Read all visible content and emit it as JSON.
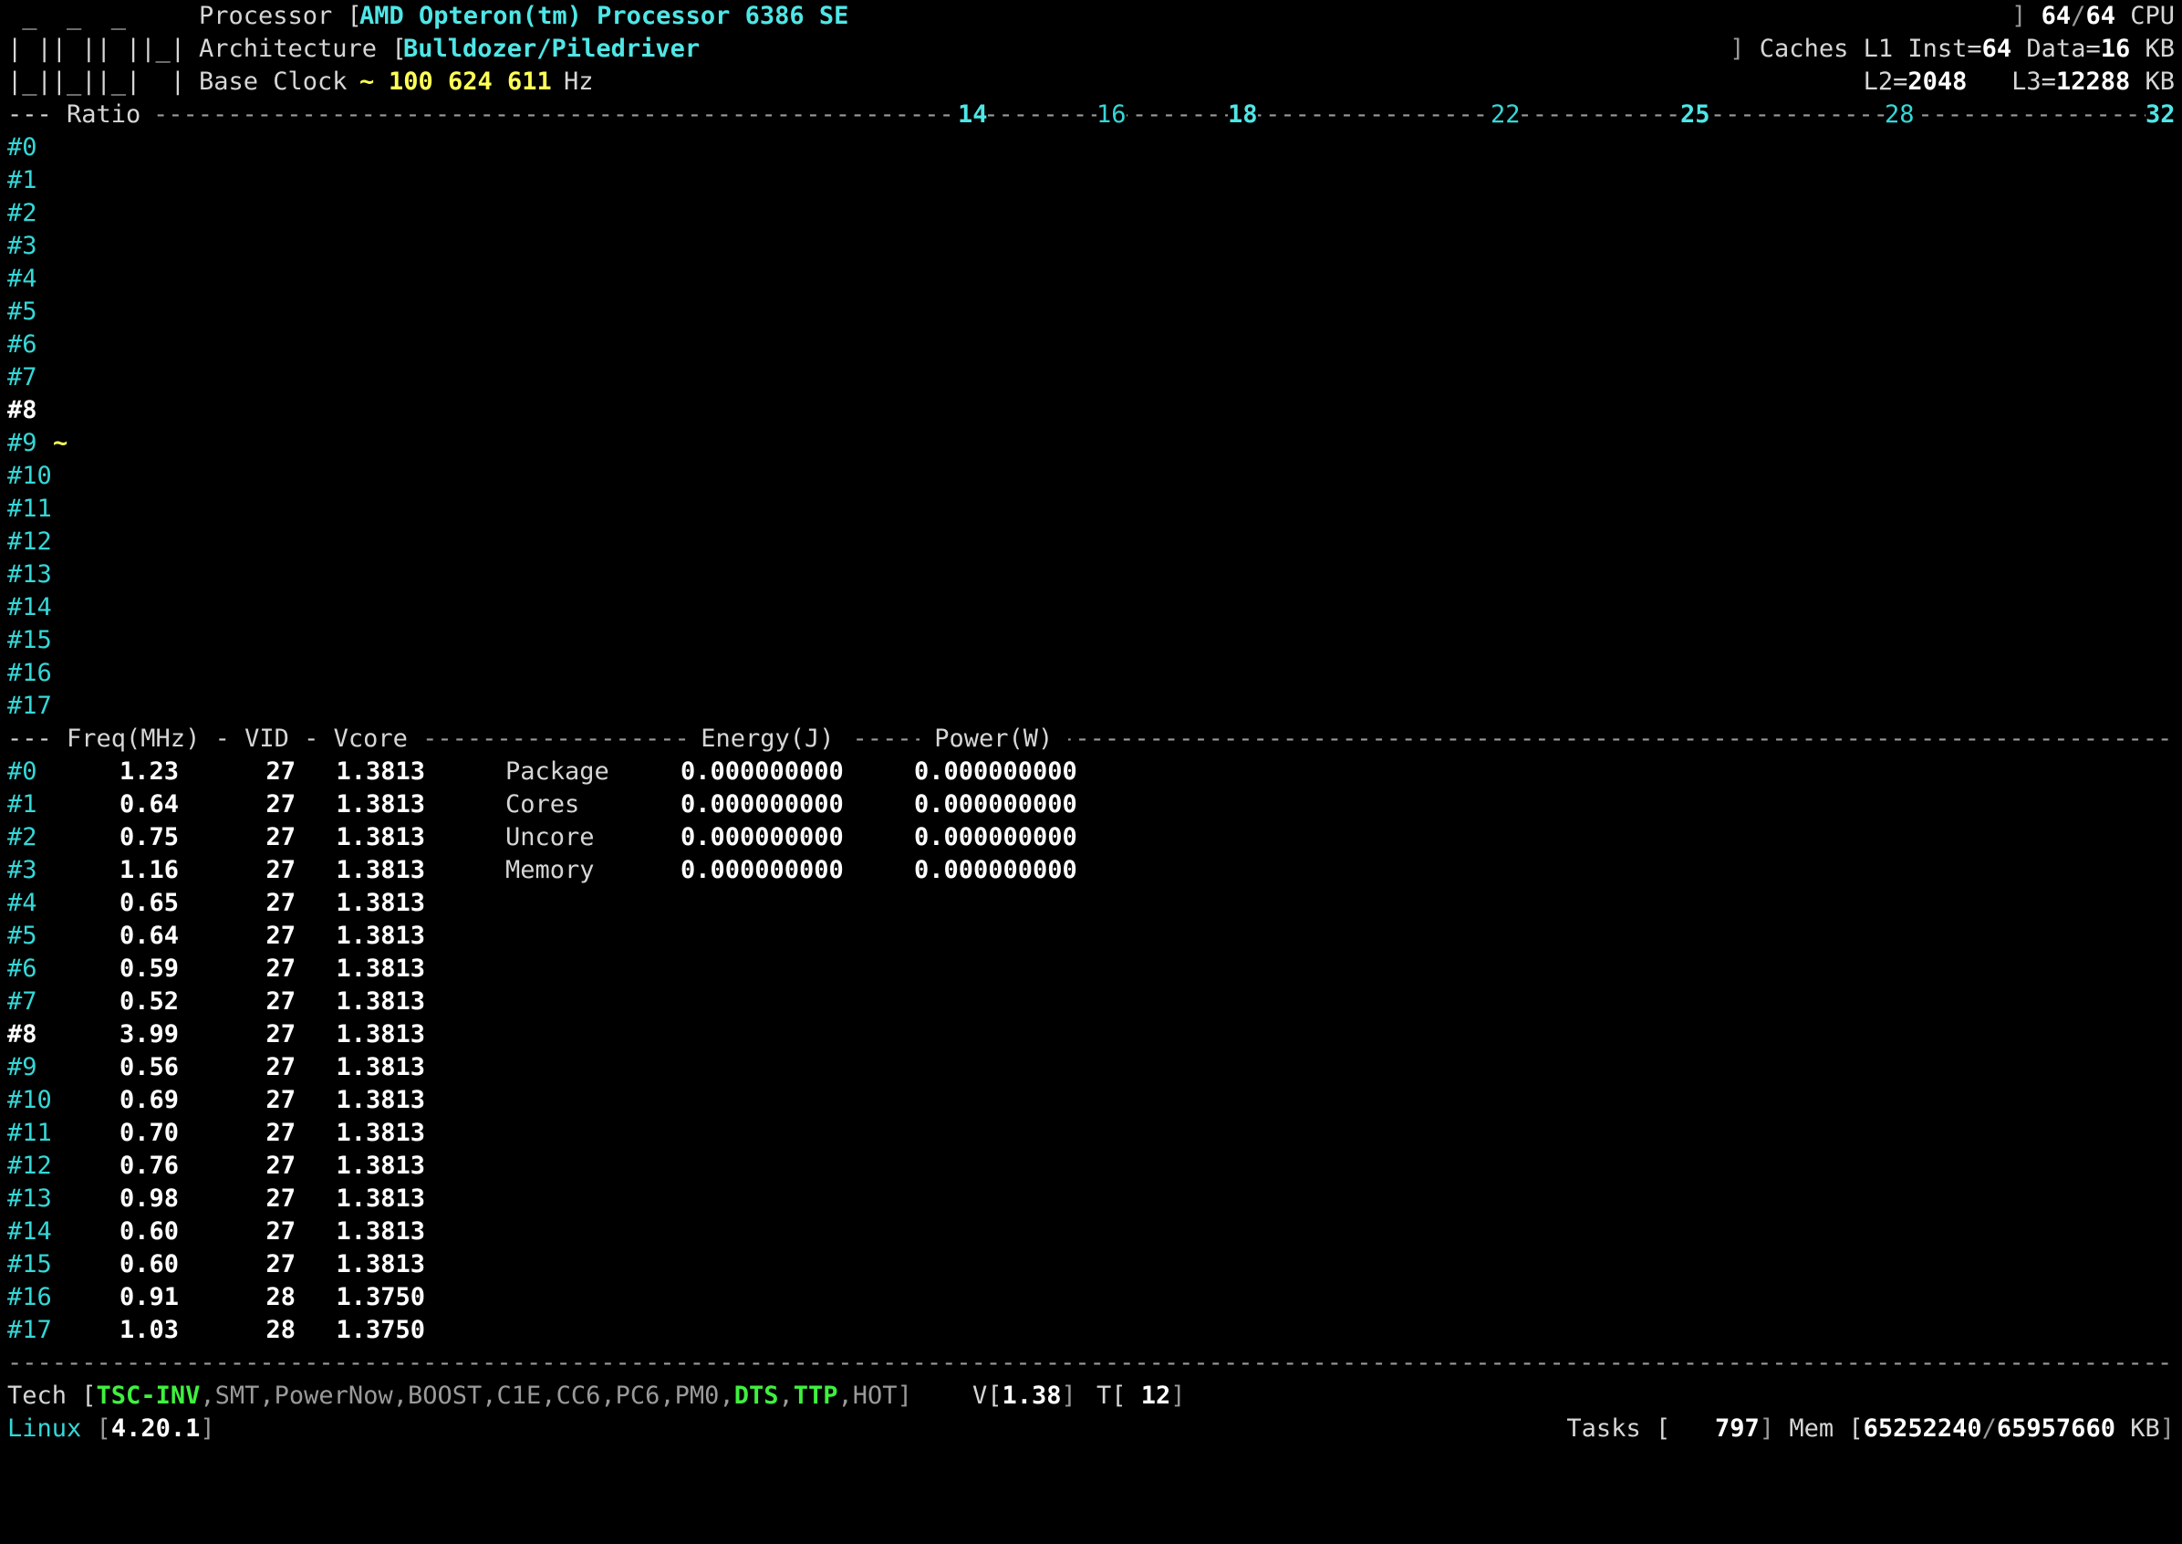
{
  "header": {
    "logo_lines": [
      " _  _  _",
      "| || || ||_|",
      "|_||_||_|  |"
    ],
    "processor_label": "Processor [",
    "processor_name": "AMD Opteron(tm) Processor 6386 SE",
    "cpu_bracket": "]",
    "cpu_online": "64",
    "cpu_slash": "/",
    "cpu_total": "64",
    "cpu_label": "CPU",
    "architecture_label": "Architecture [",
    "architecture_name": "Bulldozer/Piledriver",
    "caches_bracket": "]",
    "caches_label": "Caches L1 Inst=",
    "l1_inst": "64",
    "l1_data_label": "Data=",
    "l1_data": "16",
    "kb_label": "KB",
    "base_clock_label": "Base Clock",
    "base_clock_tilde": "~",
    "base_clock_value": "100 624 611",
    "hz_label": "Hz",
    "l2_label": "L2=",
    "l2": "2048",
    "l3_label": "L3=",
    "l3": "12288",
    "kb2_label": "KB"
  },
  "ratio_bar": {
    "label": "--- Ratio ",
    "ticks": [
      "14",
      "16",
      "18",
      "22",
      "25",
      "28",
      "32"
    ]
  },
  "ratio_cores": [
    "#0",
    "#1",
    "#2",
    "#3",
    "#4",
    "#5",
    "#6",
    "#7",
    "#8",
    "#9",
    "#10",
    "#11",
    "#12",
    "#13",
    "#14",
    "#15",
    "#16",
    "#17"
  ],
  "ratio_marker": "~",
  "freq_header": {
    "freq": "--- Freq(MHz) - VID - Vcore ",
    "energy": " Energy(J) ",
    "power": " Power(W) "
  },
  "cores": [
    {
      "id": "#0",
      "freq": "1.23",
      "vid": "27",
      "vcore": "1.3813"
    },
    {
      "id": "#1",
      "freq": "0.64",
      "vid": "27",
      "vcore": "1.3813"
    },
    {
      "id": "#2",
      "freq": "0.75",
      "vid": "27",
      "vcore": "1.3813"
    },
    {
      "id": "#3",
      "freq": "1.16",
      "vid": "27",
      "vcore": "1.3813"
    },
    {
      "id": "#4",
      "freq": "0.65",
      "vid": "27",
      "vcore": "1.3813"
    },
    {
      "id": "#5",
      "freq": "0.64",
      "vid": "27",
      "vcore": "1.3813"
    },
    {
      "id": "#6",
      "freq": "0.59",
      "vid": "27",
      "vcore": "1.3813"
    },
    {
      "id": "#7",
      "freq": "0.52",
      "vid": "27",
      "vcore": "1.3813"
    },
    {
      "id": "#8",
      "freq": "3.99",
      "vid": "27",
      "vcore": "1.3813"
    },
    {
      "id": "#9",
      "freq": "0.56",
      "vid": "27",
      "vcore": "1.3813"
    },
    {
      "id": "#10",
      "freq": "0.69",
      "vid": "27",
      "vcore": "1.3813"
    },
    {
      "id": "#11",
      "freq": "0.70",
      "vid": "27",
      "vcore": "1.3813"
    },
    {
      "id": "#12",
      "freq": "0.76",
      "vid": "27",
      "vcore": "1.3813"
    },
    {
      "id": "#13",
      "freq": "0.98",
      "vid": "27",
      "vcore": "1.3813"
    },
    {
      "id": "#14",
      "freq": "0.60",
      "vid": "27",
      "vcore": "1.3813"
    },
    {
      "id": "#15",
      "freq": "0.60",
      "vid": "27",
      "vcore": "1.3813"
    },
    {
      "id": "#16",
      "freq": "0.91",
      "vid": "28",
      "vcore": "1.3750"
    },
    {
      "id": "#17",
      "freq": "1.03",
      "vid": "28",
      "vcore": "1.3750"
    }
  ],
  "power_domains": [
    {
      "name": "Package",
      "energy": "0.000000000",
      "power": "0.000000000"
    },
    {
      "name": "Cores",
      "energy": "0.000000000",
      "power": "0.000000000"
    },
    {
      "name": "Uncore",
      "energy": "0.000000000",
      "power": "0.000000000"
    },
    {
      "name": "Memory",
      "energy": "0.000000000",
      "power": "0.000000000"
    }
  ],
  "footer": {
    "tech_label": "Tech [",
    "tech_flags": [
      {
        "text": "TSC-INV",
        "on": true
      },
      {
        "text": "SMT",
        "on": false
      },
      {
        "text": "PowerNow",
        "on": false
      },
      {
        "text": "BOOST",
        "on": false
      },
      {
        "text": "C1E",
        "on": false
      },
      {
        "text": "CC6",
        "on": false
      },
      {
        "text": "PC6",
        "on": false
      },
      {
        "text": "PM0",
        "on": false
      },
      {
        "text": "DTS",
        "on": true
      },
      {
        "text": "TTP",
        "on": true
      },
      {
        "text": "HOT",
        "on": false
      }
    ],
    "tech_close": "]",
    "v_label": "V[",
    "v_value": "1.38",
    "v_close": "]",
    "t_label": "T[",
    "t_value": " 12",
    "t_close": "]",
    "os_name": "Linux",
    "kernel_open": "[",
    "kernel": "4.20.1",
    "kernel_close": "]",
    "tasks_label": "Tasks [",
    "tasks": "797",
    "tasks_close": "]",
    "mem_label": "Mem [",
    "mem_used": "65252240",
    "mem_slash": "/",
    "mem_total": "65957660",
    "mem_unit": "KB",
    "mem_close": "]"
  }
}
